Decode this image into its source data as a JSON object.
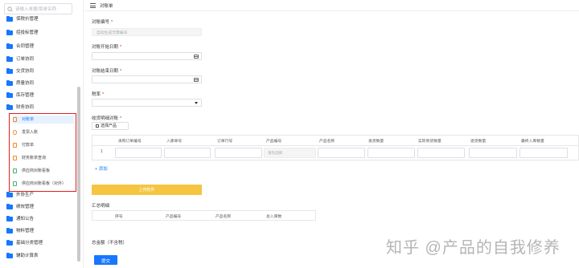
{
  "sidebar": {
    "search_placeholder": "请输入单据/菜单名称",
    "items": [
      {
        "label": "保税价管理"
      },
      {
        "label": "招投标管理"
      },
      {
        "label": "合同管理"
      },
      {
        "label": "订单协同"
      },
      {
        "label": "交货协同"
      },
      {
        "label": "质量协同"
      },
      {
        "label": "库存管理"
      },
      {
        "label": "财务协同"
      }
    ],
    "sub_items": [
      {
        "label": "对账单",
        "active": true
      },
      {
        "label": "发票入账"
      },
      {
        "label": "付款单"
      },
      {
        "label": "财务账单查询"
      },
      {
        "label": "供应商对账看板"
      },
      {
        "label": "供应商对账看板（对外）"
      }
    ],
    "items_after": [
      {
        "label": "外协生产"
      },
      {
        "label": "绩效管理"
      },
      {
        "label": "通知公告"
      },
      {
        "label": "物料管理"
      },
      {
        "label": "基础分类管理"
      },
      {
        "label": "辅助计算表"
      }
    ]
  },
  "header": {
    "breadcrumb": "对账单"
  },
  "form": {
    "statement_no": {
      "label": "对账编号",
      "placeholder": "自动生成无需编号"
    },
    "start_date": {
      "label": "对账开始日期"
    },
    "end_date": {
      "label": "对账结束日期"
    },
    "tax_rate": {
      "label": "税率"
    },
    "detail_section": {
      "label": "收货明细对账",
      "select_btn": "选择产品"
    },
    "detail_columns": [
      "采购订单编号",
      "入库单号",
      "订单行号",
      "产品编号",
      "产品名称",
      "发货数量",
      "实际到货数量",
      "退货数量",
      "最终入库数量"
    ],
    "detail_row": {
      "num": "1",
      "product_code_placeholder": "请先选择"
    },
    "add_link": "+ 添加",
    "upload_btn": "上传附件",
    "summary_section": {
      "label": "汇总明细",
      "columns": [
        "序号",
        "产品编号",
        "产品名称",
        "总入库数"
      ]
    },
    "total_label": "总金额（不含税）",
    "submit": "提交"
  },
  "watermark": "知乎 @产品的自我修养",
  "colors": {
    "accent": "#1677ff",
    "upload": "#f5c542",
    "highlight_box": "#e02020"
  }
}
